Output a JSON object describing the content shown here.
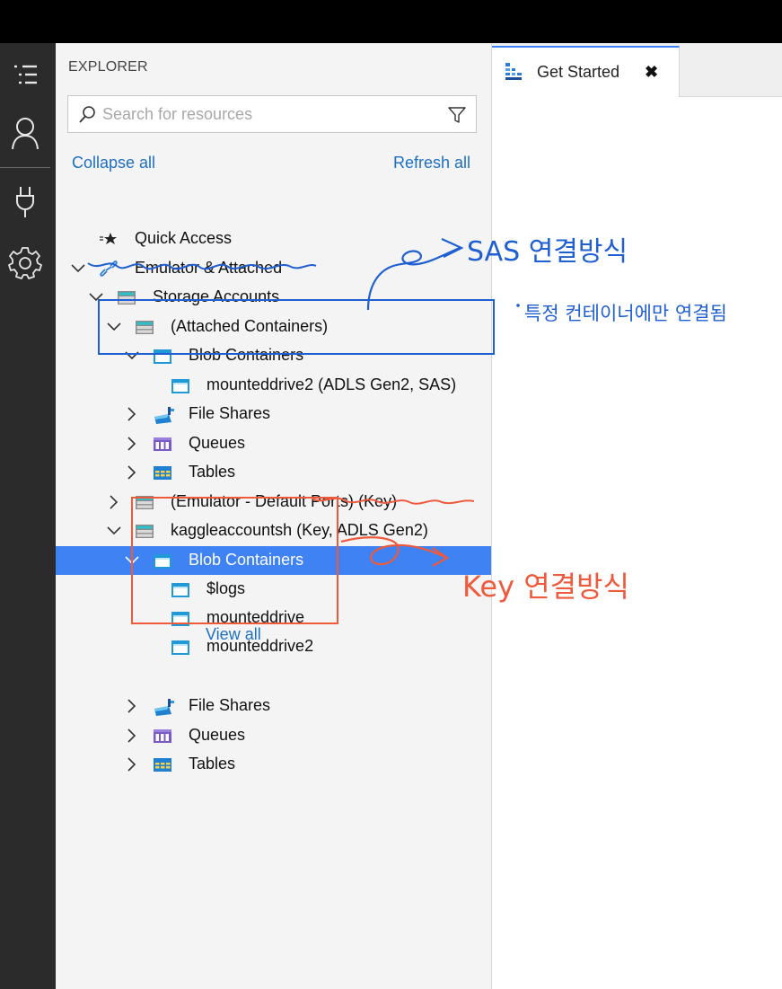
{
  "explorer": {
    "title": "EXPLORER",
    "search_placeholder": "Search for resources",
    "collapse_all": "Collapse all",
    "refresh_all": "Refresh all"
  },
  "tree": [
    {
      "label": "Quick Access",
      "icon": "quick-access-icon",
      "expander": "none"
    },
    {
      "label": "Emulator & Attached",
      "icon": "link-icon",
      "expander": "expanded"
    },
    {
      "label": "Storage Accounts",
      "icon": "storage-account-icon",
      "expander": "expanded"
    },
    {
      "label": "(Attached Containers)",
      "icon": "storage-account-icon",
      "expander": "expanded"
    },
    {
      "label": "Blob Containers",
      "icon": "blob-container-icon",
      "expander": "expanded"
    },
    {
      "label": "mounteddrive2 (ADLS Gen2, SAS)",
      "icon": "blob-container-icon",
      "expander": "none"
    },
    {
      "label": "File Shares",
      "icon": "file-share-icon",
      "expander": "collapsed"
    },
    {
      "label": "Queues",
      "icon": "queue-icon",
      "expander": "collapsed"
    },
    {
      "label": "Tables",
      "icon": "table-icon",
      "expander": "collapsed"
    },
    {
      "label": "(Emulator - Default Ports) (Key)",
      "icon": "storage-account-icon",
      "expander": "collapsed"
    },
    {
      "label": "kaggleaccountsh (Key, ADLS Gen2)",
      "icon": "storage-account-icon",
      "expander": "expanded"
    },
    {
      "label": "Blob Containers",
      "icon": "blob-container-icon",
      "expander": "expanded",
      "selected": true
    },
    {
      "label": "$logs",
      "icon": "blob-container-icon",
      "expander": "none"
    },
    {
      "label": "mounteddrive",
      "icon": "blob-container-icon",
      "expander": "none"
    },
    {
      "label": "mounteddrive2",
      "icon": "blob-container-icon",
      "expander": "none"
    },
    {
      "label": "File Shares",
      "icon": "file-share-icon",
      "expander": "collapsed"
    },
    {
      "label": "Queues",
      "icon": "queue-icon",
      "expander": "collapsed"
    },
    {
      "label": "Tables",
      "icon": "table-icon",
      "expander": "collapsed"
    }
  ],
  "view_all": "View all",
  "tabs": [
    {
      "label": "Get Started",
      "close": "✖",
      "active": true
    }
  ],
  "activity_bar": [
    "explorer-icon",
    "account-icon",
    "plug-icon",
    "gear-icon"
  ],
  "annotations": {
    "sas_title": "SAS 연결방식",
    "sas_note": "특정 컨테이너에만 연결됨",
    "key_title": "Key 연결방식"
  },
  "colors": {
    "selection": "#3f82f4",
    "link": "#1d6fc0",
    "annotation_blue": "#1f5fd1",
    "annotation_orange": "#ee5a3c"
  }
}
